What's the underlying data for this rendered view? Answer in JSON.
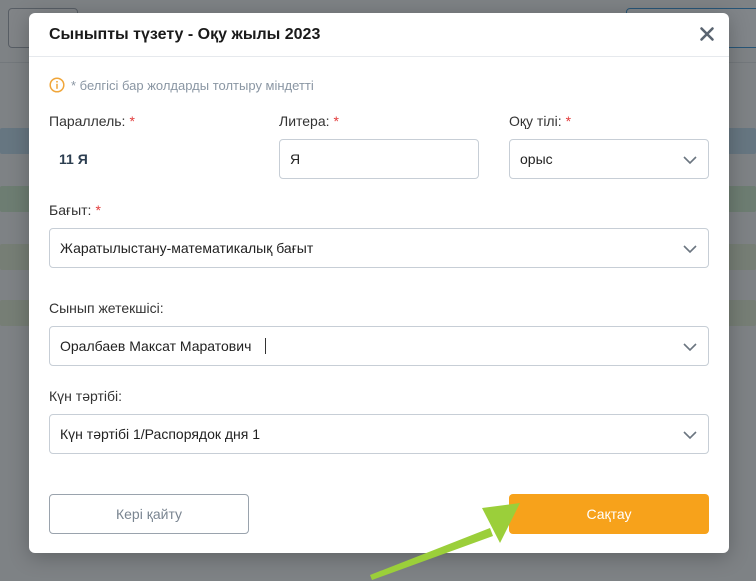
{
  "modal": {
    "title": "Сыныпты түзету - Оқу жылы 2023",
    "notice": "* белгісі бар жолдарды толтыру міндетті",
    "required_mark": "*"
  },
  "fields": {
    "parallel": {
      "label": "Параллель:",
      "value": "11 Я"
    },
    "litera": {
      "label": "Литера:",
      "value": "Я"
    },
    "language": {
      "label": "Оқу тілі:",
      "value": "орыс"
    },
    "direction": {
      "label": "Бағыт:",
      "value": "Жаратылыстану-математикалық бағыт"
    },
    "teacher": {
      "label": "Сынып жетекшісі:",
      "value": "Оралбаев Максат Маратович"
    },
    "schedule": {
      "label": "Күн тәртібі:",
      "value": "Күн тәртібі 1/Распорядок дня 1"
    }
  },
  "buttons": {
    "back": "Кері қайту",
    "save": "Сақтау"
  },
  "colors": {
    "accent": "#f7a21b",
    "required": "#e23b3b",
    "annotation_arrow": "#9bcf3a"
  }
}
